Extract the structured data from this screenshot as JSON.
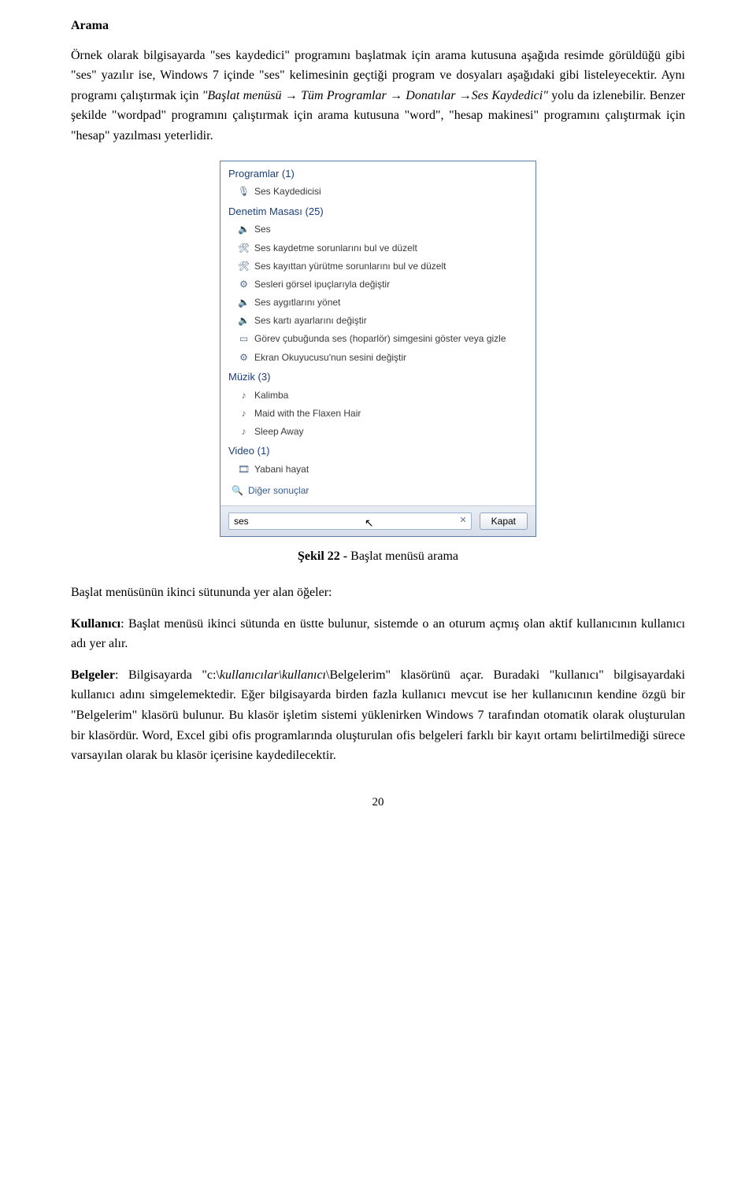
{
  "doc": {
    "heading": "Arama",
    "para1_a": "Örnek olarak bilgisayarda \"ses kaydedici\" programını başlatmak için arama kutusuna aşağıda resimde görüldüğü gibi \"ses\" yazılır ise, Windows 7 içinde \"ses\" kelimesinin geçtiği program ve dosyaları aşağıdaki gibi listeleyecektir. Aynı programı çalıştırmak için ",
    "para1_italic": "\"Başlat menüsü → Tüm Programlar → Donatılar →Ses Kaydedici\"",
    "para1_b": " yolu da izlenebilir. Benzer şekilde \"wordpad\" programını çalıştırmak için arama kutusuna \"word\", \"hesap makinesi\" programını çalıştırmak için \"hesap\" yazılması yeterlidir.",
    "caption_bold": "Şekil 22 -",
    "caption_rest": " Başlat menüsü arama",
    "para2_a": "Başlat menüsünün ikinci sütununda yer alan öğeler:",
    "para2_b_bold": "Kullanıcı",
    "para2_b_rest": ": Başlat menüsü ikinci sütunda en üstte bulunur, sistemde o an oturum açmış olan aktif kullanıcının kullanıcı adı yer alır.",
    "para3_bold": "Belgeler",
    "para3_a": ": Bilgisayarda \"c:\\",
    "para3_italic": "kullanıcılar\\kullanıcı",
    "para3_b": "\\Belgelerim\" klasörünü açar. Buradaki \"kullanıcı\" bilgisayardaki kullanıcı adını simgelemektedir. Eğer bilgisayarda birden fazla kullanıcı mevcut ise her kullanıcının kendine özgü bir \"Belgelerim\" klasörü bulunur. Bu klasör işletim sistemi yüklenirken Windows 7 tarafından otomatik olarak oluşturulan bir klasördür. Word, Excel gibi ofis programlarında oluşturulan ofis belgeleri farklı bir kayıt ortamı belirtilmediği sürece varsayılan olarak bu klasör içerisine kaydedilecektir.",
    "page_number": "20"
  },
  "startmenu": {
    "groups": [
      {
        "label": "Programlar (1)",
        "items": [
          {
            "icon": "app-icon",
            "label": "Ses Kaydedicisi"
          }
        ]
      },
      {
        "label": "Denetim Masası (25)",
        "items": [
          {
            "icon": "speaker-icon",
            "label": "Ses"
          },
          {
            "icon": "troubleshoot-icon",
            "label": "Ses kaydetme sorunlarını bul ve düzelt"
          },
          {
            "icon": "troubleshoot-icon",
            "label": "Ses kayıttan yürütme sorunlarını bul ve düzelt"
          },
          {
            "icon": "gear-icon",
            "label": "Sesleri görsel ipuçlarıyla değiştir"
          },
          {
            "icon": "speaker-icon",
            "label": "Ses aygıtlarını yönet"
          },
          {
            "icon": "speaker-icon",
            "label": "Ses kartı ayarlarını değiştir"
          },
          {
            "icon": "taskbar-icon",
            "label": "Görev çubuğunda ses (hoparlör) simgesini göster veya gizle"
          },
          {
            "icon": "gear-icon",
            "label": "Ekran Okuyucusu'nun sesini değiştir"
          }
        ]
      },
      {
        "label": "Müzik (3)",
        "items": [
          {
            "icon": "music-icon",
            "label": "Kalimba"
          },
          {
            "icon": "music-icon",
            "label": "Maid with the Flaxen Hair"
          },
          {
            "icon": "music-icon",
            "label": "Sleep Away"
          }
        ]
      },
      {
        "label": "Video (1)",
        "items": [
          {
            "icon": "video-icon",
            "label": "Yabani hayat"
          }
        ]
      }
    ],
    "more_results": "Diğer sonuçlar",
    "search_value": "ses",
    "close_button": "Kapat"
  }
}
